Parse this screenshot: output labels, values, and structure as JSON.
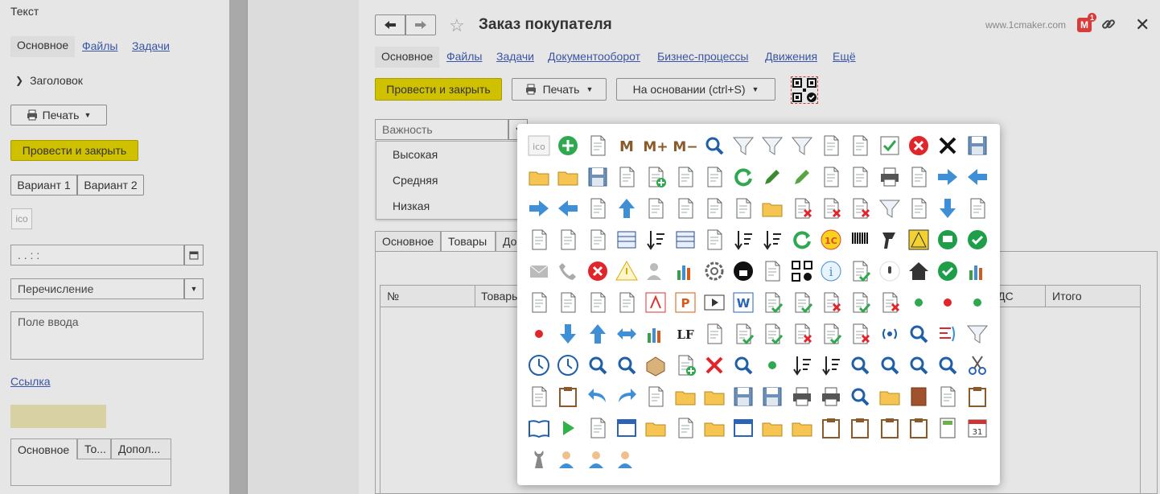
{
  "left_panel": {
    "text_label": "Текст",
    "tabs": [
      "Основное",
      "Файлы",
      "Задачи"
    ],
    "header_group": "Заголовок",
    "print_button": "Печать",
    "post_close_button": "Провести и закрыть",
    "variant1": "Вариант 1",
    "variant2": "Вариант 2",
    "ico_label": "ico",
    "date_value": ". . : :",
    "enum_value": "Перечисление",
    "textarea_value": "Поле ввода",
    "link_text": "Ссылка",
    "bottom_tabs": [
      "Основное",
      "То...",
      "Допол..."
    ]
  },
  "main": {
    "title": "Заказ покупателя",
    "site": "www.1cmaker.com",
    "badge": "1",
    "tabs": [
      "Основное",
      "Файлы",
      "Задачи",
      "Документооборот",
      "Бизнес-процессы",
      "Движения",
      "Ещё"
    ],
    "post_close_button": "Провести и закрыть",
    "print_button": "Печать",
    "based_on_button": "На основании (ctrl+S)",
    "importance_placeholder": "Важность",
    "importance_options": [
      "Высокая",
      "Средняя",
      "Низкая"
    ],
    "inner_tabs": [
      "Основное",
      "Товары",
      "До"
    ],
    "table_headers": [
      "№",
      "Товары",
      "НДС",
      "Итого"
    ]
  },
  "colors": {
    "accent_yellow": "#cfc000",
    "link_blue": "#3a55a5",
    "icon_blue": "#3f8fd6",
    "icon_green": "#2fa84f",
    "icon_red": "#e0262b"
  },
  "icons": [
    "ico-placeholder-icon",
    "add-circle-icon",
    "new-document-icon",
    "m-icon",
    "m-plus-icon",
    "m-minus-icon",
    "find-in-list-icon",
    "filter-check-icon",
    "filter-icon",
    "filter-remove-icon",
    "move-left-icon",
    "move-right-icon",
    "check-icon",
    "close-circle-icon",
    "close-x-icon",
    "save-icon",
    "folder-up-icon",
    "folder-down-icon",
    "save-ok-icon",
    "stack-cursor-icon",
    "add-document-icon",
    "export-icon",
    "import-icon",
    "refresh-icon",
    "edit-icon",
    "edit-green-icon",
    "settings-doc-icon",
    "select-cursor-icon",
    "print-stack-icon",
    "list-import-icon",
    "arrow-right-icon",
    "arrow-left-icon",
    "double-right-icon",
    "double-left-icon",
    "copy-left-icon",
    "arrow-up-icon",
    "copy-right-icon",
    "list-doc-icon",
    "tree-doc-icon",
    "tree-icon",
    "add-folder-icon",
    "remove-doc-icon",
    "delete-struct-icon",
    "delete-mark-icon",
    "filter-stack-icon",
    "move-back-icon",
    "arrow-down-icon",
    "schedule-back-icon",
    "stack-time-icon",
    "stack-forward-icon",
    "stack-forward-time-icon",
    "table-icon",
    "table-sort-icon",
    "lines-icon",
    "list-down-icon",
    "sort-az-icon",
    "sort-za-icon",
    "reload-icon",
    "1c-icon",
    "barcode-icon",
    "scanner-icon",
    "chart-triangle-icon",
    "chat-icon",
    "ok-circle-icon",
    "mail-icon",
    "phone-icon",
    "hangup-icon",
    "warning-icon",
    "users-icon",
    "bar-chart-icon",
    "gear-icon",
    "lock-circle-icon",
    "text-doc-icon",
    "qr-code-icon",
    "info-icon",
    "stack-check-icon",
    "microphone-icon",
    "home-icon",
    "check-circle-icon",
    "chart-stack-icon",
    "sigma-doc-icon",
    "doc-image-icon",
    "doc-table-icon",
    "doc-list-icon",
    "pdf-icon",
    "powerpoint-icon",
    "video-icon",
    "word-icon",
    "doc-ok-icon",
    "doc-ok2-icon",
    "doc-error-icon",
    "doc-error-ok-icon",
    "doc-error-multi-icon",
    "green-dot-icon",
    "red-dot-icon",
    "green-dot2-icon",
    "red-dot2-icon",
    "down-blue-icon",
    "up-blue-icon",
    "split-icon",
    "traffic-icon",
    "lf-icon",
    "paragraph-icon",
    "doc-check-icon",
    "doc-check2-icon",
    "doc-cross-icon",
    "doc-cross-check-icon",
    "doc-cross-multi-icon",
    "broadcast-icon",
    "search-n-icon",
    "code-icon",
    "funnel-icon",
    "clock-icon",
    "clock-outline-icon",
    "search-icon",
    "search-refresh-icon",
    "box-icon",
    "add-line-icon",
    "red-cross-icon",
    "search-cross-icon",
    "search-dots-icon",
    "sort-up-icon",
    "sort-list-icon",
    "search-small-icon",
    "search-back-icon",
    "search-abc-icon",
    "folder-search-icon",
    "scissors-icon",
    "copy-icon",
    "paste-icon",
    "undo-icon",
    "redo-icon",
    "blank-doc-icon",
    "folder-up2-icon",
    "folder-down2-icon",
    "save2-icon",
    "save-all-icon",
    "printer-icon",
    "print-check-icon",
    "find-doc-icon",
    "folder-find-icon",
    "book-icon",
    "page-icon",
    "paste-multi-icon",
    "open-book-icon",
    "play-icon",
    "settings-list-icon",
    "new-window-icon",
    "folder-gear-icon",
    "settings-doc2-icon",
    "folder-icon",
    "window-icon",
    "folder-open-icon",
    "folder-add-icon",
    "clipboard-icon",
    "clipboard-check-icon",
    "clipboard-cross-icon",
    "clipboard-cross-check-icon",
    "calculator-icon",
    "calendar-icon",
    "wrench-icon",
    "user-lock-icon",
    "user-question-icon",
    "user-icon"
  ]
}
